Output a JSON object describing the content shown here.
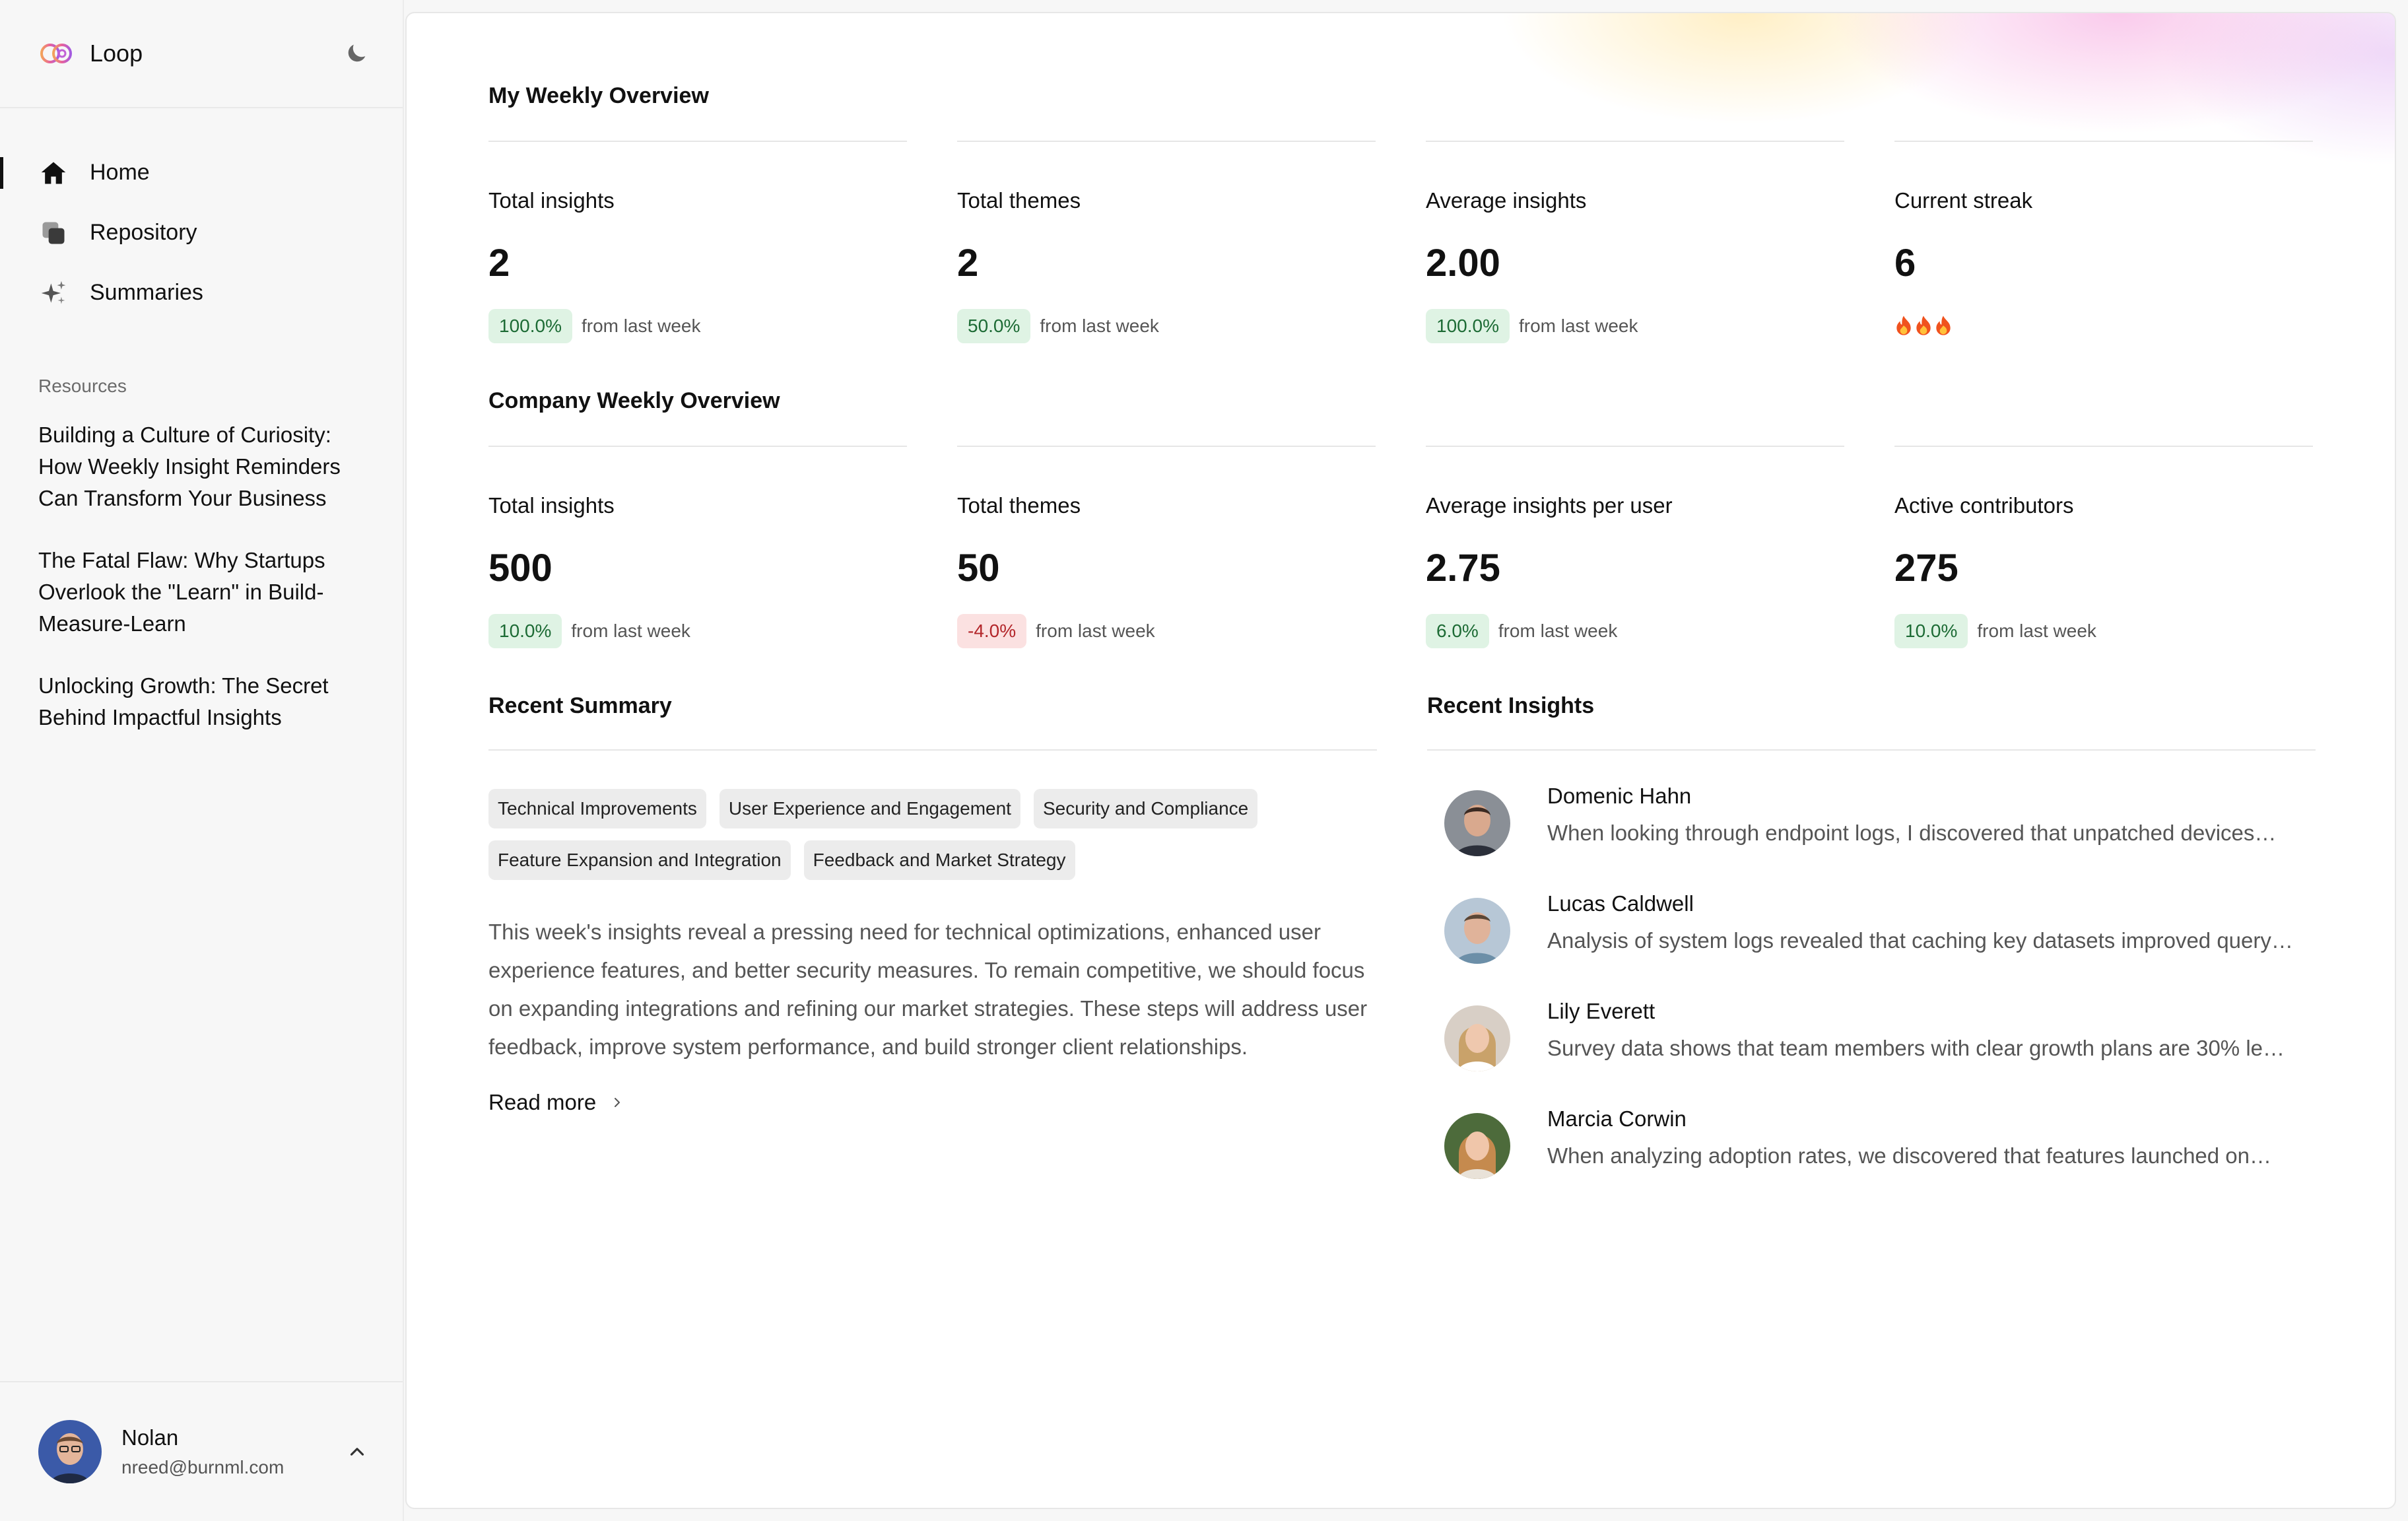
{
  "app": {
    "name": "Loop"
  },
  "nav": {
    "items": [
      {
        "label": "Home",
        "icon": "home-icon",
        "active": true
      },
      {
        "label": "Repository",
        "icon": "repository-icon",
        "active": false
      },
      {
        "label": "Summaries",
        "icon": "sparkles-icon",
        "active": false
      }
    ]
  },
  "resources": {
    "label": "Resources",
    "links": [
      "Building a Culture of Curiosity: How Weekly Insight Reminders Can Transform Your Business",
      "The Fatal Flaw: Why Startups Overlook the \"Learn\" in Build-Measure-Learn",
      "Unlocking Growth: The Secret Behind Impactful Insights"
    ]
  },
  "user": {
    "name": "Nolan",
    "email": "nreed@burnml.com"
  },
  "my_overview": {
    "title": "My Weekly Overview",
    "stats": [
      {
        "label": "Total insights",
        "value": "2",
        "change": "100.0%",
        "from": "from last week",
        "negative": false
      },
      {
        "label": "Total themes",
        "value": "2",
        "change": "50.0%",
        "from": "from last week",
        "negative": false
      },
      {
        "label": "Average insights",
        "value": "2.00",
        "change": "100.0%",
        "from": "from last week",
        "negative": false
      },
      {
        "label": "Current streak",
        "value": "6",
        "streak_flames": 3
      }
    ]
  },
  "company_overview": {
    "title": "Company Weekly Overview",
    "stats": [
      {
        "label": "Total insights",
        "value": "500",
        "change": "10.0%",
        "from": "from last week",
        "negative": false
      },
      {
        "label": "Total themes",
        "value": "50",
        "change": "-4.0%",
        "from": "from last week",
        "negative": true
      },
      {
        "label": "Average insights per user",
        "value": "2.75",
        "change": "6.0%",
        "from": "from last week",
        "negative": false
      },
      {
        "label": "Active contributors",
        "value": "275",
        "change": "10.0%",
        "from": "from last week",
        "negative": false
      }
    ]
  },
  "recent_summary": {
    "title": "Recent Summary",
    "tags": [
      "Technical Improvements",
      "User Experience and Engagement",
      "Security and Compliance",
      "Feature Expansion and Integration",
      "Feedback and Market Strategy"
    ],
    "text": "This week's insights reveal a pressing need for technical optimizations, enhanced user experience features, and better security measures. To remain competitive, we should focus on expanding integrations and refining our market strategies. These steps will address user feedback, improve system performance, and build stronger client relationships.",
    "read_more": "Read more"
  },
  "recent_insights": {
    "title": "Recent Insights",
    "items": [
      {
        "name": "Domenic Hahn",
        "text": "When looking through endpoint logs, I discovered that unpatched devices…"
      },
      {
        "name": "Lucas Caldwell",
        "text": "Analysis of system logs revealed that caching key datasets improved query…"
      },
      {
        "name": "Lily Everett",
        "text": "Survey data shows that team members with clear growth plans are 30% le…"
      },
      {
        "name": "Marcia Corwin",
        "text": "When analyzing adoption rates, we discovered that features launched on…"
      }
    ]
  },
  "colors": {
    "positive_pill_bg": "#dff3e4",
    "positive_pill_text": "#1d6b35",
    "negative_pill_bg": "#fbe1e1",
    "negative_pill_text": "#b3262a"
  }
}
